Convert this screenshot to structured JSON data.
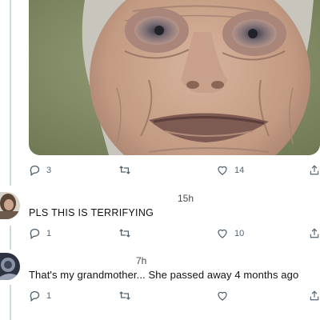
{
  "post": {
    "media_alt": "close-up photo of an elderly woman's face",
    "counts": {
      "replies": "3",
      "likes": "14"
    }
  },
  "replies": [
    {
      "time": "15h",
      "text": "PLS THIS IS TERRIFYING",
      "counts": {
        "replies": "1",
        "likes": "10"
      }
    },
    {
      "time": "7h",
      "text": "That's my grandmother... She passed away 4 months ago",
      "counts": {
        "replies": "1",
        "likes": ""
      }
    }
  ],
  "icons": [
    "reply-icon",
    "retweet-icon",
    "like-icon",
    "share-icon"
  ],
  "colors": {
    "icon": "#536471",
    "background": "#ffffff",
    "thread_line": "#cfd9de"
  }
}
